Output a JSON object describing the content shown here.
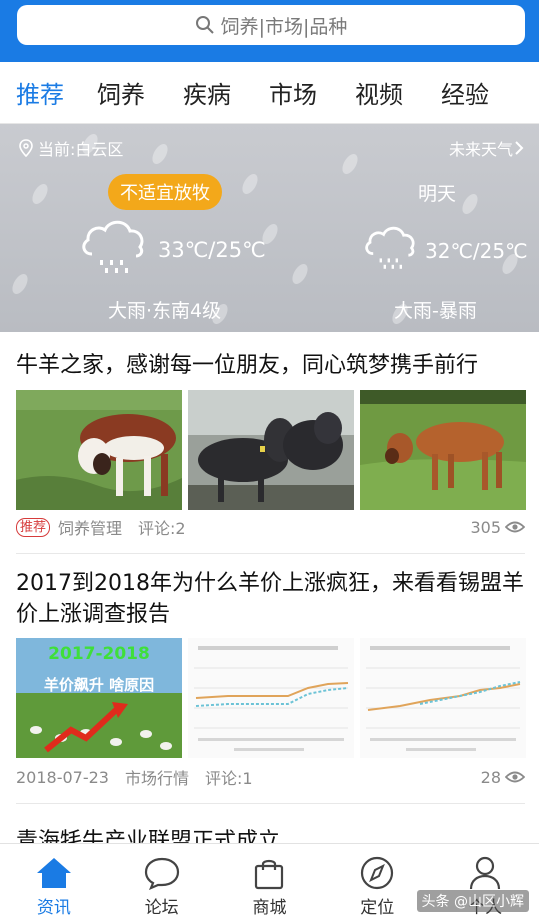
{
  "search": {
    "placeholder": "饲养|市场|品种",
    "icon": "search-icon"
  },
  "tabs": [
    "推荐",
    "饲养",
    "疾病",
    "市场",
    "视频",
    "经验"
  ],
  "weather": {
    "location": "当前:白云区",
    "future_link": "未来天气",
    "warning": "不适宜放牧",
    "today": {
      "temp": "33℃/25℃",
      "condition": "大雨·东南4级",
      "icon": "rain-cloud-icon"
    },
    "tomorrow": {
      "label": "明天",
      "temp": "32℃/25℃",
      "condition": "大雨-暴雨",
      "icon": "rain-cloud-icon"
    }
  },
  "articles": [
    {
      "title": "牛羊之家，感谢每一位朋友，同心筑梦携手前行",
      "tag": "推荐",
      "category": "饲养管理",
      "comments": "评论:2",
      "views": "305"
    },
    {
      "title": "2017到2018年为什么羊价上涨疯狂，来看看锡盟羊价上涨调查报告",
      "thumb_caption_1": "2017-2018",
      "thumb_caption_2": "羊价飙升  啥原因",
      "date": "2018-07-23",
      "category": "市场行情",
      "comments": "评论:1",
      "views": "28"
    },
    {
      "title": "青海牦牛产业联盟正式成立"
    }
  ],
  "bottom_nav": [
    {
      "label": "资讯",
      "icon": "home-icon",
      "active": true
    },
    {
      "label": "论坛",
      "icon": "chat-bubble-icon",
      "active": false
    },
    {
      "label": "商城",
      "icon": "shopping-bag-icon",
      "active": false
    },
    {
      "label": "定位",
      "icon": "compass-icon",
      "active": false
    },
    {
      "label": "个人",
      "icon": "person-icon",
      "active": false
    }
  ],
  "watermark": "头条 @山区小辉",
  "colors": {
    "accent": "#1a7be4",
    "warning": "#f3a81a",
    "tag": "#d63b3b"
  }
}
